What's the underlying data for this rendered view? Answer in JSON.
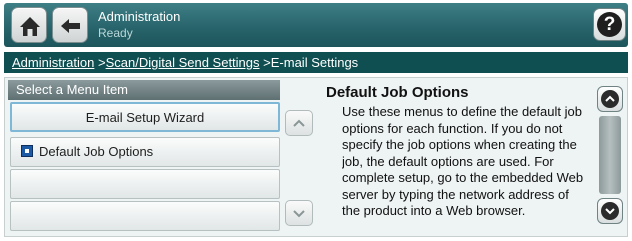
{
  "header": {
    "title": "Administration",
    "status": "Ready",
    "help_label": "?"
  },
  "breadcrumb": {
    "items": [
      "Administration",
      "Scan/Digital Send Settings",
      "E-mail Settings"
    ],
    "separator": " >"
  },
  "menu": {
    "header": "Select a Menu Item",
    "items": [
      {
        "label": "E-mail Setup Wizard",
        "selected": true
      },
      {
        "label": "Default Job Options",
        "icon": "folder-square-icon"
      },
      {
        "label": ""
      },
      {
        "label": ""
      }
    ]
  },
  "detail": {
    "title": "Default Job Options",
    "text": "Use these menus to define the default job options for each function. If you do not specify the job options when creating the job, the default options are used. For complete setup, go to the embedded Web server by typing the network address of the product into a Web browser."
  },
  "colors": {
    "titlebar": "#28646b",
    "breadcrumb": "#0f4f51",
    "selection_border": "#7fb8d6"
  }
}
